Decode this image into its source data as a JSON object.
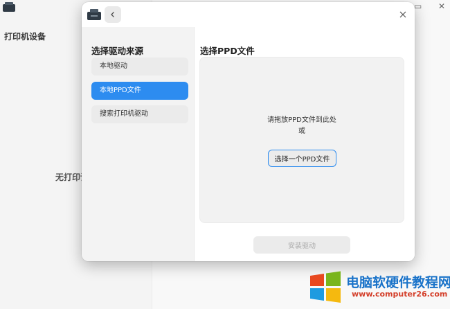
{
  "background_app": {
    "title": "打印机设备",
    "empty_text": "无打印设备",
    "maximize_icon": "maximize-icon",
    "close_icon": "close-icon"
  },
  "dialog": {
    "app_icon": "printer-icon",
    "back_icon": "chevron-left-icon",
    "close_icon": "close-icon",
    "sidebar": {
      "title": "选择驱动来源",
      "items": [
        {
          "label": "本地驱动",
          "active": false
        },
        {
          "label": "本地PPD文件",
          "active": true
        },
        {
          "label": "搜索打印机驱动",
          "active": false
        }
      ]
    },
    "main": {
      "title": "选择PPD文件",
      "drop_hint": "请拖放PPD文件到此处",
      "or_text": "或",
      "choose_button": "选择一个PPD文件",
      "install_button": "安装驱动"
    }
  },
  "watermark": {
    "text": "电脑软硬件教程网",
    "url": "www.computer26.com"
  },
  "colors": {
    "accent": "#2d8cf0",
    "watermark_blue": "#1a73c9",
    "watermark_red": "#d4402b"
  }
}
